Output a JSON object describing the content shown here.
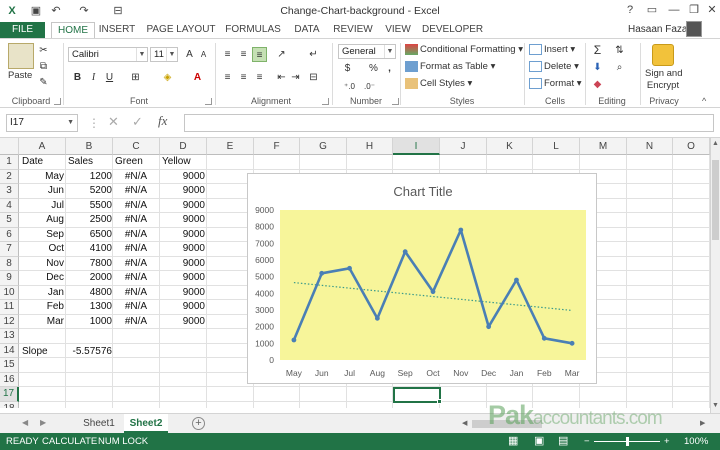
{
  "window": {
    "title": "Change-Chart-background - Excel",
    "user": "Hasaan Fazal"
  },
  "ribbon_tabs": [
    "FILE",
    "HOME",
    "INSERT",
    "PAGE LAYOUT",
    "FORMULAS",
    "DATA",
    "REVIEW",
    "VIEW",
    "DEVELOPER"
  ],
  "ribbon": {
    "clipboard": {
      "label": "Clipboard",
      "paste": "Paste"
    },
    "font": {
      "label": "Font",
      "name": "Calibri",
      "size": "11"
    },
    "alignment": {
      "label": "Alignment"
    },
    "number": {
      "label": "Number",
      "format": "General",
      "currency": "$",
      "percent": "%",
      "comma": ","
    },
    "styles": {
      "label": "Styles",
      "conditional": "Conditional Formatting",
      "format_table": "Format as Table",
      "cell_styles": "Cell Styles"
    },
    "cells": {
      "label": "Cells",
      "insert": "Insert",
      "delete": "Delete",
      "format": "Format"
    },
    "editing": {
      "label": "Editing"
    },
    "privacy": {
      "label": "Privacy",
      "sign_line1": "Sign and",
      "sign_line2": "Encrypt"
    }
  },
  "formula_bar": {
    "name_box": "I17",
    "fx": "fx",
    "value": ""
  },
  "columns": [
    "A",
    "B",
    "C",
    "D",
    "E",
    "F",
    "G",
    "H",
    "I",
    "J",
    "K",
    "L",
    "M",
    "N",
    "O"
  ],
  "selected_column": "I",
  "selected_row": 17,
  "rows": [
    "1",
    "2",
    "3",
    "4",
    "5",
    "6",
    "7",
    "8",
    "9",
    "10",
    "11",
    "12",
    "13",
    "14",
    "15",
    "16",
    "17",
    "18"
  ],
  "cells": {
    "header": [
      "Date",
      "Sales",
      "Green",
      "Yellow"
    ],
    "data": [
      [
        "May",
        "1200",
        "#N/A",
        "9000"
      ],
      [
        "Jun",
        "5200",
        "#N/A",
        "9000"
      ],
      [
        "Jul",
        "5500",
        "#N/A",
        "9000"
      ],
      [
        "Aug",
        "2500",
        "#N/A",
        "9000"
      ],
      [
        "Sep",
        "6500",
        "#N/A",
        "9000"
      ],
      [
        "Oct",
        "4100",
        "#N/A",
        "9000"
      ],
      [
        "Nov",
        "7800",
        "#N/A",
        "9000"
      ],
      [
        "Dec",
        "2000",
        "#N/A",
        "9000"
      ],
      [
        "Jan",
        "4800",
        "#N/A",
        "9000"
      ],
      [
        "Feb",
        "1300",
        "#N/A",
        "9000"
      ],
      [
        "Mar",
        "1000",
        "#N/A",
        "9000"
      ]
    ],
    "slope_label": "Slope",
    "slope_value": "-5.57576"
  },
  "chart_data": {
    "type": "line",
    "title": "Chart Title",
    "categories": [
      "May",
      "Jun",
      "Jul",
      "Aug",
      "Sep",
      "Oct",
      "Nov",
      "Dec",
      "Jan",
      "Feb",
      "Mar"
    ],
    "series": [
      {
        "values": [
          1200,
          5200,
          5500,
          2500,
          6500,
          4100,
          7800,
          2000,
          4800,
          1300,
          1000
        ],
        "color": "#4a7fb5"
      }
    ],
    "trendline": {
      "type": "linear",
      "style": "dotted",
      "color": "#3a9a8a"
    },
    "ylim": [
      0,
      9000
    ],
    "yticks": [
      0,
      1000,
      2000,
      3000,
      4000,
      5000,
      6000,
      7000,
      8000,
      9000
    ],
    "plot_background": "#f7f59a",
    "grid": false
  },
  "sheets": [
    "Sheet1",
    "Sheet2"
  ],
  "active_sheet": "Sheet2",
  "status": {
    "ready": "READY",
    "calculate": "CALCULATE",
    "numlock": "NUM LOCK",
    "zoom": "100%"
  },
  "watermark": {
    "brand": "Pak",
    "suffix": "accountants.com"
  },
  "colors": {
    "excel_green": "#217346",
    "plot_fill": "#f7f59a",
    "line": "#4a7fb5"
  }
}
